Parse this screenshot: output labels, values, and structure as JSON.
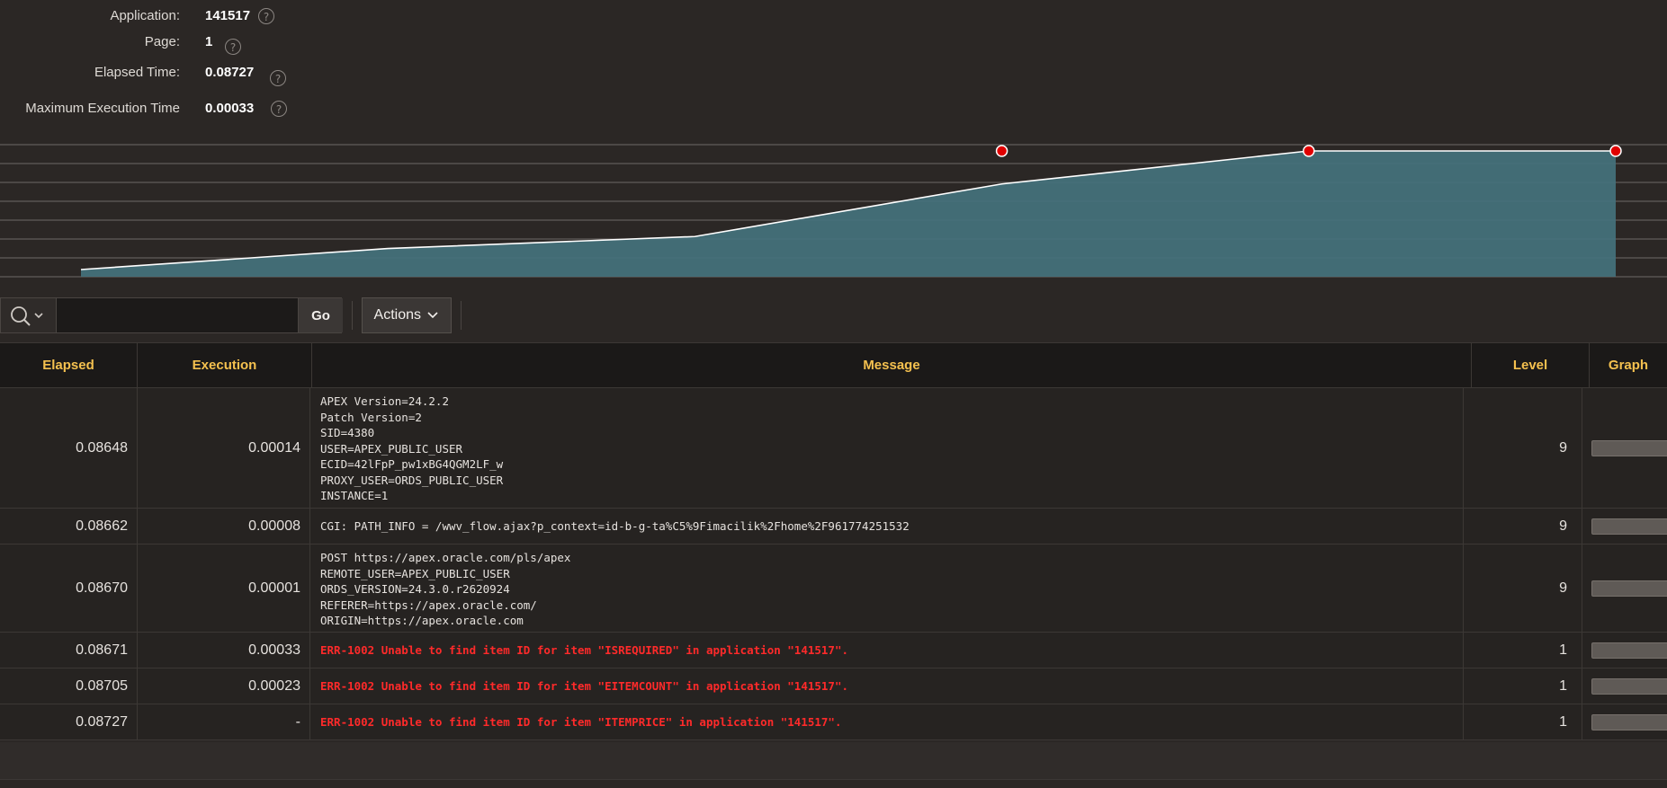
{
  "summary": {
    "application_label": "Application:",
    "application_value": "141517",
    "page_label": "Page:",
    "page_value": "1",
    "elapsed_label": "Elapsed Time:",
    "elapsed_value": "0.08727",
    "max_exec_label": "Maximum Execution Time",
    "max_exec_value": "0.00033",
    "help_glyph": "?"
  },
  "chart_data": {
    "type": "area",
    "x": [
      1,
      2,
      3,
      4,
      5,
      6
    ],
    "y": [
      0.08648,
      0.08662,
      0.0867,
      0.08705,
      0.08727,
      0.08727
    ],
    "markers": [
      4,
      5,
      6
    ],
    "marker_color": "#e00000",
    "fill_color": "#44727c",
    "line_color": "#ffffff",
    "grid": true
  },
  "toolbar": {
    "search_icon": "search-icon",
    "search_placeholder": "",
    "go_label": "Go",
    "actions_label": "Actions"
  },
  "table": {
    "headers": {
      "elapsed": "Elapsed",
      "execution": "Execution",
      "message": "Message",
      "level": "Level",
      "graph": "Graph"
    },
    "rows": [
      {
        "elapsed": "0.08648",
        "execution": "0.00014",
        "message": "APEX Version=24.2.2\nPatch Version=2\nSID=4380\nUSER=APEX_PUBLIC_USER\nECID=42lFpP_pw1xBG4QGM2LF_w\nPROXY_USER=ORDS_PUBLIC_USER\nINSTANCE=1",
        "level": "9",
        "error": false
      },
      {
        "elapsed": "0.08662",
        "execution": "0.00008",
        "message": "CGI: PATH_INFO = /wwv_flow.ajax?p_context=id-b-g-ta%C5%9Fimacilik%2Fhome%2F961774251532",
        "level": "9",
        "error": false
      },
      {
        "elapsed": "0.08670",
        "execution": "0.00001",
        "message": "POST https://apex.oracle.com/pls/apex\nREMOTE_USER=APEX_PUBLIC_USER\nORDS_VERSION=24.3.0.r2620924\nREFERER=https://apex.oracle.com/\nORIGIN=https://apex.oracle.com",
        "level": "9",
        "error": false
      },
      {
        "elapsed": "0.08671",
        "execution": "0.00033",
        "message": "ERR-1002 Unable to find item ID for item \"ISREQUIRED\" in application \"141517\".",
        "level": "1",
        "error": true
      },
      {
        "elapsed": "0.08705",
        "execution": "0.00023",
        "message": "ERR-1002 Unable to find item ID for item \"EITEMCOUNT\" in application \"141517\".",
        "level": "1",
        "error": true
      },
      {
        "elapsed": "0.08727",
        "execution": "-",
        "message": "ERR-1002 Unable to find item ID for item \"ITEMPRICE\" in application \"141517\".",
        "level": "1",
        "error": true
      }
    ]
  }
}
